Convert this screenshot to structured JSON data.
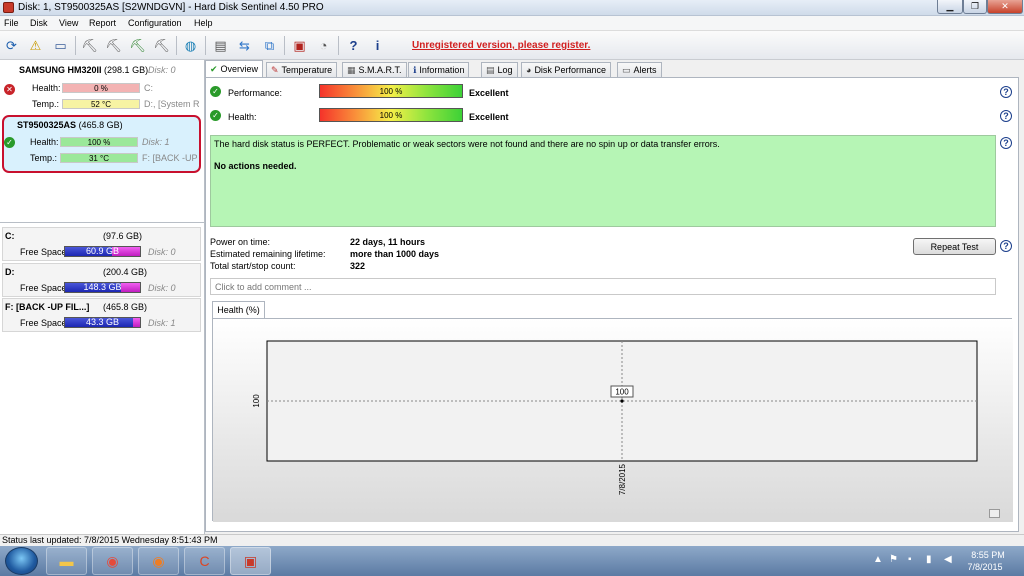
{
  "window": {
    "title": "Disk: 1, ST9500325AS [S2WNDGVN]  -  Hard Disk Sentinel 4.50 PRO"
  },
  "menu": [
    "File",
    "Disk",
    "View",
    "Report",
    "Configuration",
    "Help"
  ],
  "toolbar": {
    "register_text": "Unregistered version, please register."
  },
  "disks": [
    {
      "name": "SAMSUNG HM320II",
      "size": "(298.1 GB)",
      "disk_index": "Disk: 0",
      "status": "error",
      "health_label": "Health:",
      "health_value": "0 %",
      "health_percent": 0,
      "temp_label": "Temp.:",
      "temp_value": "52 °C",
      "drive_1": "C:",
      "drive_2": "D:, [System R"
    },
    {
      "name": "ST9500325AS",
      "size": "(465.8 GB)",
      "disk_index": "Disk: 1",
      "status": "ok",
      "health_label": "Health:",
      "health_value": "100 %",
      "health_percent": 100,
      "temp_label": "Temp.:",
      "temp_value": "31 °C",
      "drive_1": "",
      "drive_2": "F: [BACK -UP"
    }
  ],
  "volumes": [
    {
      "name": "C:",
      "size": "(97.6 GB)",
      "free_label": "Free Space",
      "free_value": "60.9 GB",
      "free_fraction": 0.62,
      "disk": "Disk: 0"
    },
    {
      "name": "D:",
      "size": "(200.4 GB)",
      "free_label": "Free Space",
      "free_value": "148.3 GB",
      "free_fraction": 0.74,
      "disk": "Disk: 0"
    },
    {
      "name": "F: [BACK -UP FIL...]",
      "size": "(465.8 GB)",
      "free_label": "Free Space",
      "free_value": "43.3 GB",
      "free_fraction": 0.91,
      "disk": "Disk: 1"
    }
  ],
  "tabs": [
    "Overview",
    "Temperature",
    "S.M.A.R.T.",
    "Information",
    "Log",
    "Disk Performance",
    "Alerts"
  ],
  "overview": {
    "performance_label": "Performance:",
    "performance_value": "100 %",
    "performance_rating": "Excellent",
    "health_label": "Health:",
    "health_value": "100 %",
    "health_rating": "Excellent",
    "status_message": "The hard disk status is PERFECT. Problematic or weak sectors were not found and there are no spin up or data transfer errors.",
    "status_action": "No actions needed.",
    "power_on_label": "Power on time:",
    "power_on_value": "22 days, 11 hours",
    "lifetime_label": "Estimated remaining lifetime:",
    "lifetime_value": "more than 1000 days",
    "startstop_label": "Total start/stop count:",
    "startstop_value": "322",
    "repeat_test_label": "Repeat Test",
    "comment_placeholder": "Click to add comment ...",
    "chart_tab_label": "Health (%)"
  },
  "chart_data": {
    "type": "line",
    "x": [
      "7/8/2015"
    ],
    "values": [
      100
    ],
    "ylabel_tick": "100",
    "data_label": "100",
    "grid": true
  },
  "statusbar": {
    "text": "Status last updated: 7/8/2015 Wednesday 8:51:43 PM"
  },
  "taskbar": {
    "time": "8:55 PM",
    "date": "7/8/2015"
  },
  "colors": {
    "register": "#d11f1f",
    "status_ok_bg": "#b6f5b5",
    "selected_disk_border": "#c8102e"
  }
}
